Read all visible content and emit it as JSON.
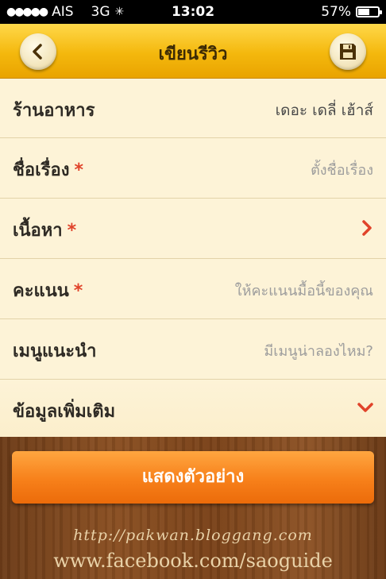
{
  "status_bar": {
    "carrier": "AIS",
    "network": "3G",
    "time": "13:02",
    "battery_percent": "57%",
    "battery_level": 0.57
  },
  "nav": {
    "title": "เขียนรีวิว",
    "back_icon": "back-arrow-icon",
    "save_icon": "floppy-disk-icon"
  },
  "form": {
    "restaurant": {
      "label": "ร้านอาหาร",
      "value": "เดอะ เดลี่ เฮ้าส์"
    },
    "title": {
      "label": "ชื่อเรื่อง",
      "required": "*",
      "placeholder": "ตั้งชื่อเรื่อง"
    },
    "content": {
      "label": "เนื้อหา",
      "required": "*"
    },
    "rating": {
      "label": "คะแนน",
      "required": "*",
      "placeholder": "ให้คะแนนมื้อนี้ของคุณ"
    },
    "menu": {
      "label": "เมนูแนะนำ",
      "placeholder": "มีเมนูน่าลองไหม?"
    },
    "more_info": {
      "label": "ข้อมูลเพิ่มเติม"
    }
  },
  "preview_button": {
    "label": "แสดงตัวอย่าง"
  },
  "watermark": {
    "line1": "http://pakwan.bloggang.com",
    "line2": "www.facebook.com/saoguide"
  },
  "colors": {
    "accent_orange": "#f7801a",
    "required_red": "#e0432a",
    "nav_yellow": "#f4b80d"
  }
}
